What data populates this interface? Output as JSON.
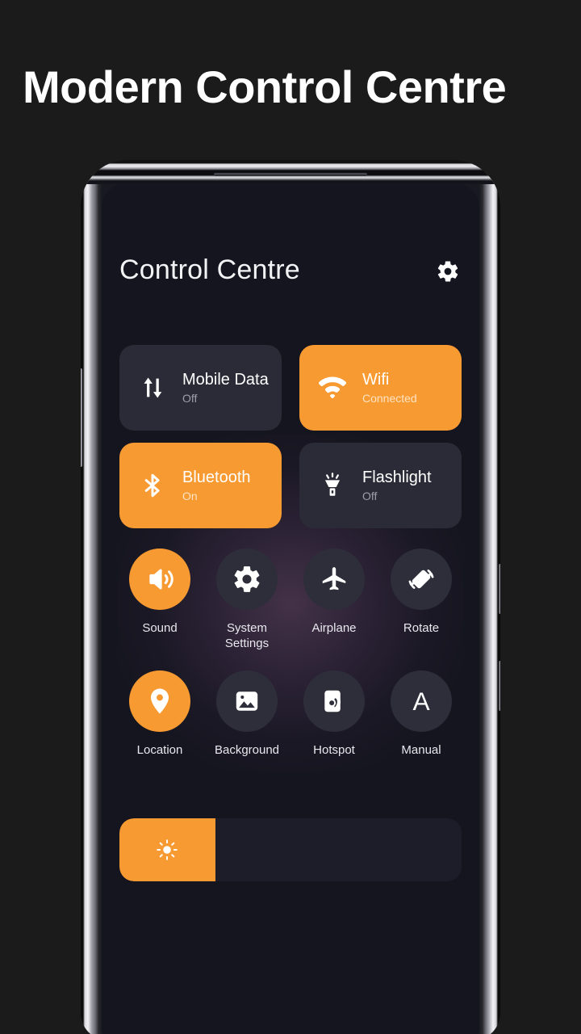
{
  "hero": {
    "title": "Modern Control Centre"
  },
  "theme": {
    "accent": "#f89a32",
    "screen_bg": "#15151f",
    "tile_off_bg": "#2b2b38",
    "circle_off_bg": "#2e2e3b",
    "text_primary": "#ffffff",
    "text_muted": "#9d9dab",
    "glow": "#b074a8"
  },
  "panel": {
    "title": "Control Centre",
    "settings_icon": "gear-icon"
  },
  "tiles": [
    {
      "label": "Mobile Data",
      "state": "Off",
      "active": false,
      "icon": "mobile-data-icon"
    },
    {
      "label": "Wifi",
      "state": "Connected",
      "active": true,
      "icon": "wifi-icon"
    },
    {
      "label": "Bluetooth",
      "state": "On",
      "active": true,
      "icon": "bluetooth-icon"
    },
    {
      "label": "Flashlight",
      "state": "Off",
      "active": false,
      "icon": "flashlight-icon"
    }
  ],
  "quick_toggles": [
    {
      "label": "Sound",
      "active": true,
      "icon": "volume-icon"
    },
    {
      "label": "System Settings",
      "active": false,
      "icon": "gear-icon"
    },
    {
      "label": "Airplane",
      "active": false,
      "icon": "airplane-icon"
    },
    {
      "label": "Rotate",
      "active": false,
      "icon": "rotate-icon"
    },
    {
      "label": "Location",
      "active": true,
      "icon": "location-pin-icon"
    },
    {
      "label": "Background",
      "active": false,
      "icon": "image-icon"
    },
    {
      "label": "Hotspot",
      "active": false,
      "icon": "hotspot-icon"
    },
    {
      "label": "Manual",
      "active": false,
      "icon": "letter-a-icon"
    }
  ],
  "brightness": {
    "icon": "brightness-sun-icon",
    "percent": 28
  }
}
